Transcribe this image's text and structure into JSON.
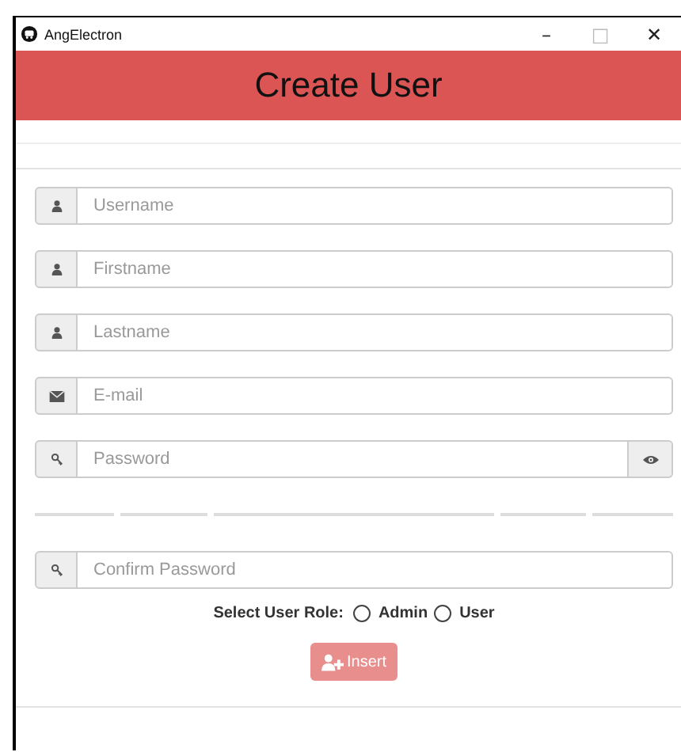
{
  "window": {
    "title": "AngElectron",
    "controls": [
      "–",
      "□",
      "✕"
    ]
  },
  "header": {
    "title": "Create User"
  },
  "fields": [
    {
      "kind": "user",
      "placeholder": "Username"
    },
    {
      "kind": "user",
      "placeholder": "Firstname"
    },
    {
      "kind": "user",
      "placeholder": "Lastname"
    },
    {
      "kind": "email",
      "placeholder": "E-mail"
    },
    {
      "kind": "password",
      "placeholder": "Password",
      "reveal": true
    }
  ],
  "confirm_field": {
    "kind": "password",
    "placeholder": "Confirm Password"
  },
  "role": {
    "label": "Select User Role:",
    "options": [
      {
        "label": "Admin",
        "selected": false
      },
      {
        "label": "User",
        "selected": false
      }
    ]
  },
  "insert_button": {
    "label": "Insert",
    "disabled": true
  }
}
